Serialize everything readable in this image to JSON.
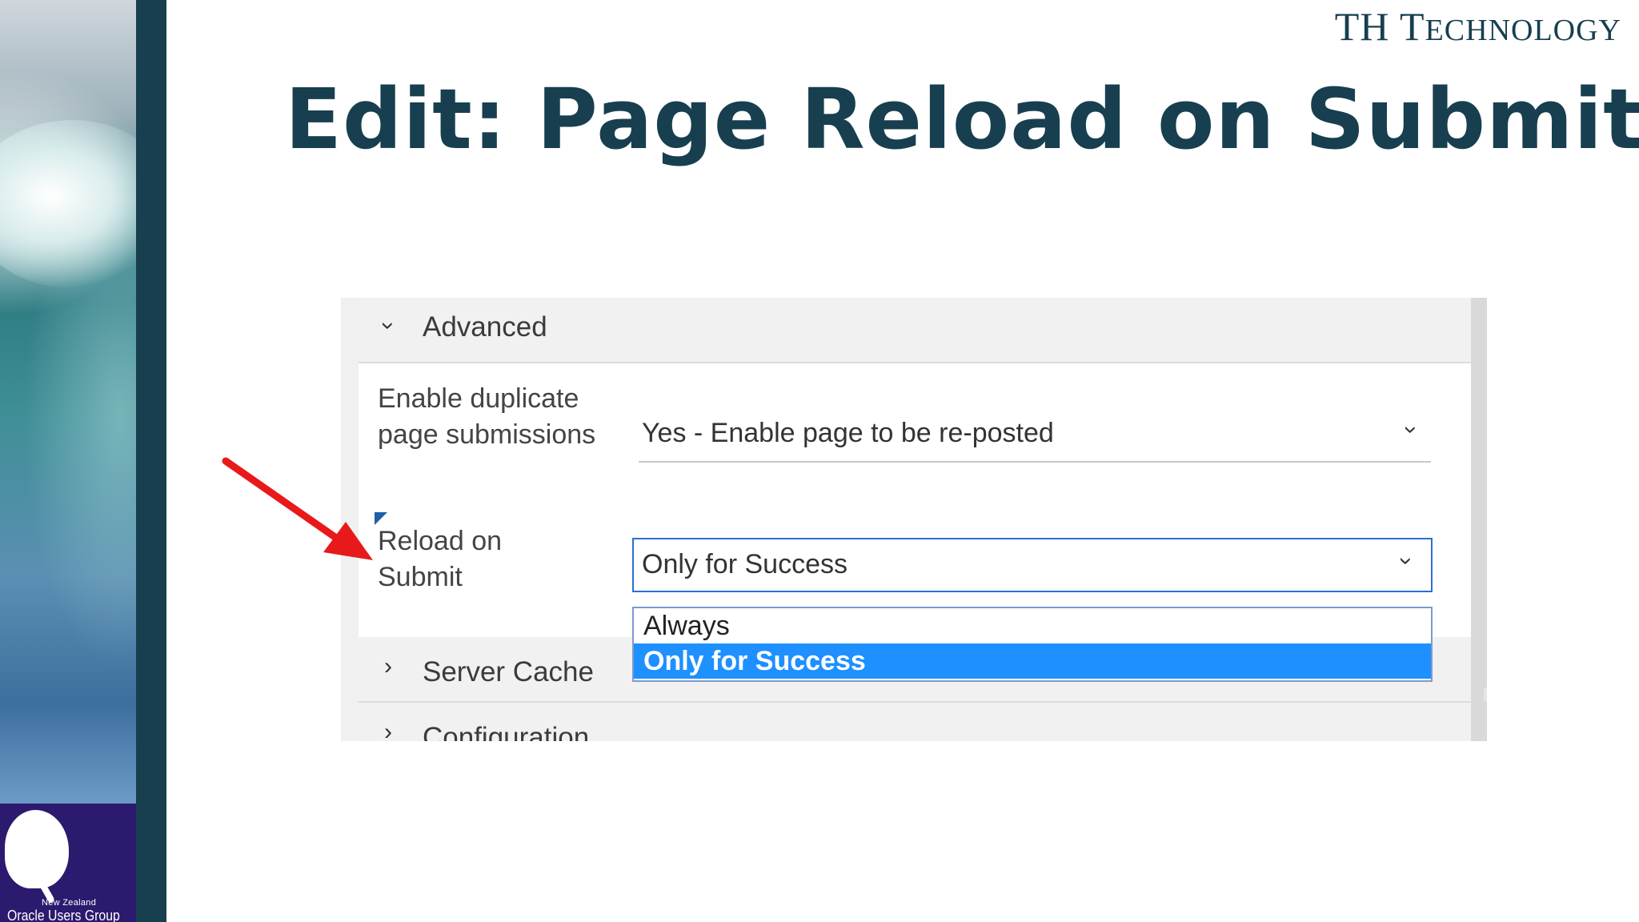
{
  "brand": {
    "text_main": "TH",
    "text_rest_first": "T",
    "text_rest_small": "ECHNOLOGY"
  },
  "slide": {
    "title": "Edit: Page Reload on Submit"
  },
  "logo": {
    "small": "New Zealand",
    "big": "Oracle Users Group"
  },
  "panel": {
    "advanced": {
      "label": "Advanced",
      "expanded": true
    },
    "fields": [
      {
        "label": "Enable duplicate page submissions",
        "value": "Yes - Enable page to be re-posted"
      },
      {
        "label": "Reload on Submit",
        "value": "Only for Success"
      }
    ],
    "dropdown": {
      "options": [
        "Always",
        "Only for Success"
      ],
      "selected_index": 1
    },
    "server_cache": {
      "label": "Server Cache",
      "expanded": false
    },
    "configuration": {
      "label": "Configuration",
      "expanded": false
    }
  },
  "colors": {
    "title": "#173f4f",
    "sidebar_bar": "#173f4f",
    "logo_bg": "#2c1a6e",
    "selection": "#1e90ff",
    "arrow": "#e8191a"
  },
  "icons": {
    "chevron_expanded": "chevron-down-icon",
    "chevron_collapsed": "chevron-right-icon",
    "select_caret": "chevron-down-icon"
  }
}
